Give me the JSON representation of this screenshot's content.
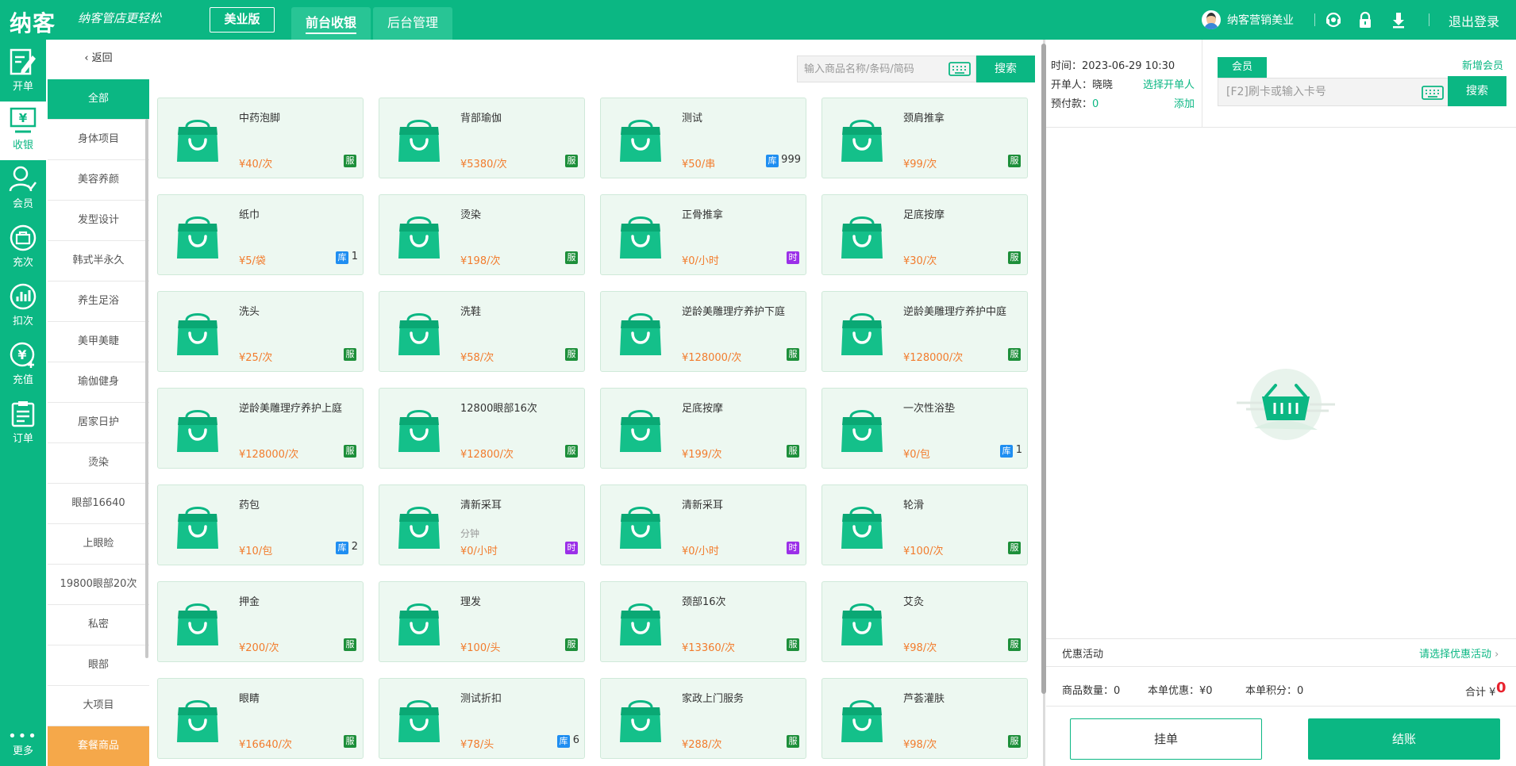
{
  "topbar": {
    "logo": "纳客",
    "slogan": "纳客管店更轻松",
    "edition": "美业版",
    "tabs": [
      {
        "label": "前台收银",
        "active": true
      },
      {
        "label": "后台管理",
        "active": false
      }
    ],
    "user_name": "纳客营销美业",
    "icons": [
      "headset-icon",
      "lock-icon",
      "download-icon"
    ],
    "logout": "退出登录"
  },
  "colors": {
    "brand": "#0bb783",
    "price": "#f27c2d",
    "service_badge": "#1d8f3a",
    "time_badge": "#9b30e8",
    "stock_badge": "#1f8ef1",
    "package": "#f5a84a",
    "total": "#e8222d"
  },
  "leftnav": {
    "items": [
      {
        "label": "开单",
        "icon": "edit-order-icon"
      },
      {
        "label": "收银",
        "icon": "cashier-icon"
      },
      {
        "label": "会员",
        "icon": "member-icon"
      },
      {
        "label": "充次",
        "icon": "recharge-times-icon"
      },
      {
        "label": "扣次",
        "icon": "deduct-times-icon"
      },
      {
        "label": "充值",
        "icon": "recharge-icon"
      },
      {
        "label": "订单",
        "icon": "order-icon"
      }
    ],
    "more": "更多"
  },
  "categories": {
    "back": "返回",
    "items": [
      "全部",
      "身体项目",
      "美容养颜",
      "发型设计",
      "韩式半永久",
      "养生足浴",
      "美甲美睫",
      "瑜伽健身",
      "居家日护",
      "烫染",
      "眼部16640",
      "上眼睑",
      "19800眼部20次",
      "私密",
      "眼部",
      "大项目"
    ],
    "package": "套餐商品"
  },
  "search": {
    "placeholder": "输入商品名称/条码/简码",
    "button": "搜索"
  },
  "products": [
    {
      "name": "中药泡脚",
      "price": "¥40/次",
      "badge": "服",
      "type": "svc"
    },
    {
      "name": "背部瑜伽",
      "price": "¥5380/次",
      "badge": "服",
      "type": "svc"
    },
    {
      "name": "测试",
      "price": "¥50/串",
      "badge": "库",
      "type": "stock",
      "stock": "999"
    },
    {
      "name": "颈肩推拿",
      "price": "¥99/次",
      "badge": "服",
      "type": "svc"
    },
    {
      "name": "纸巾",
      "price": "¥5/袋",
      "badge": "库",
      "type": "stock",
      "stock": "1"
    },
    {
      "name": "烫染",
      "price": "¥198/次",
      "badge": "服",
      "type": "svc"
    },
    {
      "name": "正骨推拿",
      "price": "¥0/小时",
      "badge": "时",
      "type": "time"
    },
    {
      "name": "足底按摩",
      "price": "¥30/次",
      "badge": "服",
      "type": "svc"
    },
    {
      "name": "洗头",
      "price": "¥25/次",
      "badge": "服",
      "type": "svc"
    },
    {
      "name": "洗鞋",
      "price": "¥58/次",
      "badge": "服",
      "type": "svc"
    },
    {
      "name": "逆龄美雕理疗养护下庭",
      "price": "¥128000/次",
      "badge": "服",
      "type": "svc"
    },
    {
      "name": "逆龄美雕理疗养护中庭",
      "price": "¥128000/次",
      "badge": "服",
      "type": "svc"
    },
    {
      "name": "逆龄美雕理疗养护上庭",
      "price": "¥128000/次",
      "badge": "服",
      "type": "svc"
    },
    {
      "name": "12800眼部16次",
      "price": "¥12800/次",
      "badge": "服",
      "type": "svc"
    },
    {
      "name": "足底按摩",
      "price": "¥199/次",
      "badge": "服",
      "type": "svc"
    },
    {
      "name": "一次性浴垫",
      "price": "¥0/包",
      "badge": "库",
      "type": "stock",
      "stock": "1"
    },
    {
      "name": "药包",
      "price": "¥10/包",
      "badge": "库",
      "type": "stock",
      "stock": "2"
    },
    {
      "name": "清新采耳",
      "sub": "分钟",
      "price": "¥0/小时",
      "badge": "时",
      "type": "time"
    },
    {
      "name": "清新采耳",
      "price": "¥0/小时",
      "badge": "时",
      "type": "time"
    },
    {
      "name": "轮滑",
      "price": "¥100/次",
      "badge": "服",
      "type": "svc"
    },
    {
      "name": "押金",
      "price": "¥200/次",
      "badge": "服",
      "type": "svc"
    },
    {
      "name": "理发",
      "price": "¥100/头",
      "badge": "服",
      "type": "svc"
    },
    {
      "name": "颈部16次",
      "price": "¥13360/次",
      "badge": "服",
      "type": "svc"
    },
    {
      "name": "艾灸",
      "price": "¥98/次",
      "badge": "服",
      "type": "svc"
    },
    {
      "name": "眼睛",
      "price": "¥16640/次",
      "badge": "服",
      "type": "svc"
    },
    {
      "name": "测试折扣",
      "price": "¥78/头",
      "badge": "库",
      "type": "stock",
      "stock": "6"
    },
    {
      "name": "家政上门服务",
      "price": "¥288/次",
      "badge": "服",
      "type": "svc"
    },
    {
      "name": "芦荟灌肤",
      "price": "¥98/次",
      "badge": "服",
      "type": "svc"
    }
  ],
  "order_info": {
    "time": "时间：2023-06-29 10:30",
    "opener": "开单人：晓晓",
    "choose_opener": "选择开单人",
    "prepay_label": "预付款：",
    "prepay_value": "0",
    "add": "添加"
  },
  "member": {
    "tab": "会员",
    "new_member": "新增会员",
    "placeholder": "[F2]刷卡或输入卡号",
    "search": "搜索"
  },
  "summary": {
    "promo_label": "优惠活动",
    "promo_link": "请选择优惠活动",
    "qty": "商品数量：0",
    "discount": "本单优惠：¥0",
    "points": "本单积分：0",
    "total_label": "合计 ¥",
    "total_value": "0",
    "hold": "挂单",
    "pay": "结账"
  }
}
